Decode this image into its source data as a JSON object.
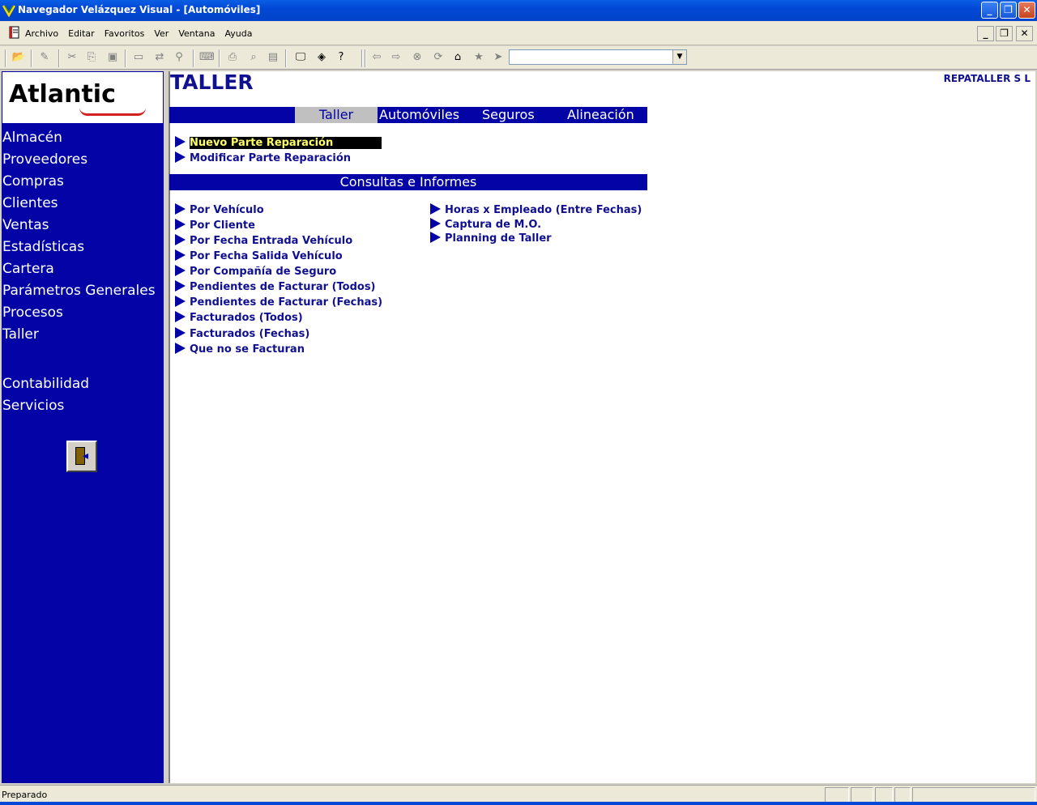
{
  "window": {
    "title": "Navegador Velázquez Visual - [Automóviles]"
  },
  "menu": [
    "Archivo",
    "Editar",
    "Favoritos",
    "Ver",
    "Ventana",
    "Ayuda"
  ],
  "toolbar": {
    "address_value": ""
  },
  "sidebar": {
    "logo_text": "Atlantic",
    "items": [
      "Almacén",
      "Proveedores",
      "Compras",
      "Clientes",
      "Ventas",
      "Estadísticas",
      "Cartera",
      "Parámetros Generales",
      "Procesos",
      "Taller"
    ],
    "items2": [
      "Contabilidad",
      "Servicios"
    ]
  },
  "page": {
    "title": "TALLER",
    "company": "REPATALLER S L",
    "tabs": [
      "Taller",
      "Automóviles",
      "Seguros",
      "Alineación"
    ],
    "actions": [
      "Nuevo Parte Reparación",
      "Modificar Parte Reparación"
    ],
    "section_title": "Consultas e Informes",
    "reports_left": [
      "Por Vehículo",
      "Por Cliente",
      "Por Fecha Entrada Vehículo",
      "Por Fecha Salida Vehículo",
      "Por Compañía de Seguro",
      "Pendientes de Facturar (Todos)",
      "Pendientes de Facturar (Fechas)",
      "Facturados (Todos)",
      "Facturados (Fechas)",
      "Que no se Facturan"
    ],
    "reports_right": [
      "Horas x Empleado (Entre Fechas)",
      "Captura de M.O.",
      "Planning de Taller"
    ]
  },
  "status": {
    "text": "Preparado"
  },
  "colors": {
    "sidebar": "#0303a6",
    "title_text": "#101090",
    "selected_bg": "#000000",
    "selected_fg": "#ffff66"
  }
}
